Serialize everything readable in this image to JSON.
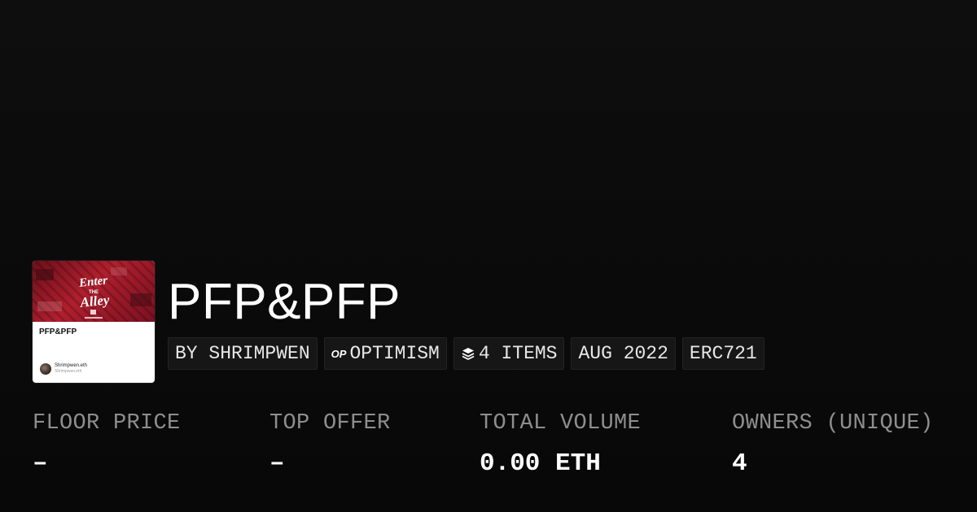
{
  "collection": {
    "title": "PFP&PFP",
    "thumbnail": {
      "card_title": "PFP&PFP",
      "owner": "Shrimpwen.eth",
      "owner_sub": "Shrimpwen.eth",
      "art_text": "ENTER THE ALLEY",
      "accent_color": "#b01f2e"
    }
  },
  "tags": [
    {
      "label": "BY SHRIMPWEN",
      "icon": null
    },
    {
      "label": "OPTIMISM",
      "icon": "optimism-icon",
      "icon_text": "OP"
    },
    {
      "label": "4 ITEMS",
      "icon": "layers-icon"
    },
    {
      "label": "AUG 2022",
      "icon": null
    },
    {
      "label": "ERC721",
      "icon": null
    }
  ],
  "stats": {
    "floor_price": {
      "label": "FLOOR PRICE",
      "value": "–"
    },
    "top_offer": {
      "label": "TOP OFFER",
      "value": "–"
    },
    "total_volume": {
      "label": "TOTAL VOLUME",
      "value": "0.00 ETH"
    },
    "owners": {
      "label": "OWNERS (UNIQUE)",
      "value": "4"
    }
  }
}
